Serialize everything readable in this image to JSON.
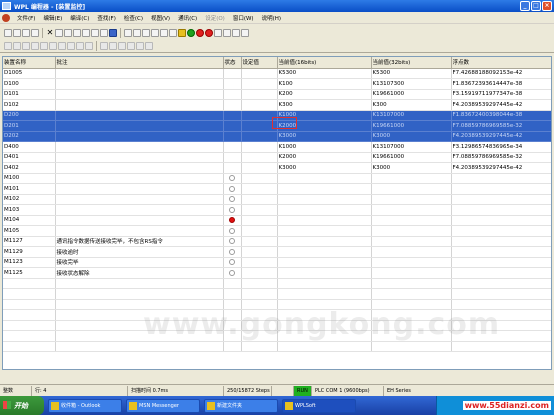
{
  "window": {
    "title": "WPL 编程器 - [装置监控]"
  },
  "menu": {
    "items": [
      {
        "label": "文件(F)",
        "dim": false
      },
      {
        "label": "编辑(E)",
        "dim": false
      },
      {
        "label": "编译(C)",
        "dim": false
      },
      {
        "label": "查找(F)",
        "dim": false
      },
      {
        "label": "检查(C)",
        "dim": false
      },
      {
        "label": "视图(V)",
        "dim": false
      },
      {
        "label": "通讯(C)",
        "dim": false
      },
      {
        "label": "设定(O)",
        "dim": true
      },
      {
        "label": "窗口(W)",
        "dim": false
      },
      {
        "label": "说明(H)",
        "dim": false
      }
    ]
  },
  "table": {
    "headers": [
      "装置名称",
      "批注",
      "状态",
      "设定值",
      "当前值(16bits)",
      "当前值(32bits)",
      "浮点数"
    ],
    "rows": [
      {
        "device": "D1005",
        "comment": "",
        "status": "",
        "setting": "",
        "v16": "K5300",
        "v32": "K5300",
        "float": "F7.42688188092153e-42",
        "selected": false
      },
      {
        "device": "D100",
        "comment": "",
        "status": "",
        "setting": "",
        "v16": "K100",
        "v32": "K13107300",
        "float": "F1.83672393614447e-38",
        "selected": false
      },
      {
        "device": "D101",
        "comment": "",
        "status": "",
        "setting": "",
        "v16": "K200",
        "v32": "K19661000",
        "float": "F3.15919711977347e-38",
        "selected": false
      },
      {
        "device": "D102",
        "comment": "",
        "status": "",
        "setting": "",
        "v16": "K300",
        "v32": "K300",
        "float": "F4.20389539297445e-42",
        "selected": false
      },
      {
        "device": "D200",
        "comment": "",
        "status": "",
        "setting": "",
        "v16": "K1000",
        "v32": "K13107000",
        "float": "F1.83672400398044e-38",
        "selected": true
      },
      {
        "device": "D201",
        "comment": "",
        "status": "",
        "setting": "",
        "v16": "K2000",
        "v32": "K19661000",
        "float": "F7.08859786969585e-32",
        "selected": true
      },
      {
        "device": "D202",
        "comment": "",
        "status": "",
        "setting": "",
        "v16": "K3000",
        "v32": "K3000",
        "float": "F4.20389539297445e-42",
        "selected": true
      },
      {
        "device": "D400",
        "comment": "",
        "status": "",
        "setting": "",
        "v16": "K1000",
        "v32": "K13107000",
        "float": "F3.12986574836965e-34",
        "selected": false
      },
      {
        "device": "D401",
        "comment": "",
        "status": "",
        "setting": "",
        "v16": "K2000",
        "v32": "K19661000",
        "float": "F7.08859786969585e-32",
        "selected": false
      },
      {
        "device": "D402",
        "comment": "",
        "status": "",
        "setting": "",
        "v16": "K3000",
        "v32": "K3000",
        "float": "F4.20389539297445e-42",
        "selected": false
      },
      {
        "device": "M100",
        "comment": "",
        "status": "off",
        "setting": "",
        "v16": "",
        "v32": "",
        "float": "",
        "selected": false
      },
      {
        "device": "M101",
        "comment": "",
        "status": "off",
        "setting": "",
        "v16": "",
        "v32": "",
        "float": "",
        "selected": false
      },
      {
        "device": "M102",
        "comment": "",
        "status": "off",
        "setting": "",
        "v16": "",
        "v32": "",
        "float": "",
        "selected": false
      },
      {
        "device": "M103",
        "comment": "",
        "status": "off",
        "setting": "",
        "v16": "",
        "v32": "",
        "float": "",
        "selected": false
      },
      {
        "device": "M104",
        "comment": "",
        "status": "on",
        "setting": "",
        "v16": "",
        "v32": "",
        "float": "",
        "selected": false
      },
      {
        "device": "M105",
        "comment": "",
        "status": "off",
        "setting": "",
        "v16": "",
        "v32": "",
        "float": "",
        "selected": false
      },
      {
        "device": "M1127",
        "comment": "通讯指令数据传送接收完毕，不包含RS指令",
        "status": "off",
        "setting": "",
        "v16": "",
        "v32": "",
        "float": "",
        "selected": false
      },
      {
        "device": "M1129",
        "comment": "接收逾时",
        "status": "off",
        "setting": "",
        "v16": "",
        "v32": "",
        "float": "",
        "selected": false
      },
      {
        "device": "M1123",
        "comment": "接收完毕",
        "status": "off",
        "setting": "",
        "v16": "",
        "v32": "",
        "float": "",
        "selected": false
      },
      {
        "device": "M1125",
        "comment": "接收状态解除",
        "status": "off",
        "setting": "",
        "v16": "",
        "v32": "",
        "float": "",
        "selected": false
      },
      {
        "device": "",
        "comment": "",
        "status": "",
        "setting": "",
        "v16": "",
        "v32": "",
        "float": "",
        "selected": false
      },
      {
        "device": "",
        "comment": "",
        "status": "",
        "setting": "",
        "v16": "",
        "v32": "",
        "float": "",
        "selected": false
      },
      {
        "device": "",
        "comment": "",
        "status": "",
        "setting": "",
        "v16": "",
        "v32": "",
        "float": "",
        "selected": false
      },
      {
        "device": "",
        "comment": "",
        "status": "",
        "setting": "",
        "v16": "",
        "v32": "",
        "float": "",
        "selected": false
      },
      {
        "device": "",
        "comment": "",
        "status": "",
        "setting": "",
        "v16": "",
        "v32": "",
        "float": "",
        "selected": false
      },
      {
        "device": "",
        "comment": "",
        "status": "",
        "setting": "",
        "v16": "",
        "v32": "",
        "float": "",
        "selected": false
      },
      {
        "device": "",
        "comment": "",
        "status": "",
        "setting": "",
        "v16": "",
        "v32": "",
        "float": "",
        "selected": false
      }
    ]
  },
  "watermark": "www.gongkong.com",
  "status": {
    "mode": "整数",
    "row": "行: 4",
    "scan_time": "扫描时间 0.7ms",
    "steps": "250/15872 Steps",
    "run": "RUN",
    "comm": "PLC COM 1 (9600bps)",
    "series": "EH Series"
  },
  "taskbar": {
    "start": "开始",
    "tasks": [
      {
        "label": "收件箱 - Outlook",
        "active": false
      },
      {
        "label": "MSN Messenger",
        "active": false
      },
      {
        "label": "新建文件夹",
        "active": false
      },
      {
        "label": "WPLSoft",
        "active": true
      }
    ],
    "site": "www.55dianzi.com"
  },
  "colors": {
    "selection": "#3162c5",
    "status_on": "#e01010",
    "run": "#20b020"
  }
}
